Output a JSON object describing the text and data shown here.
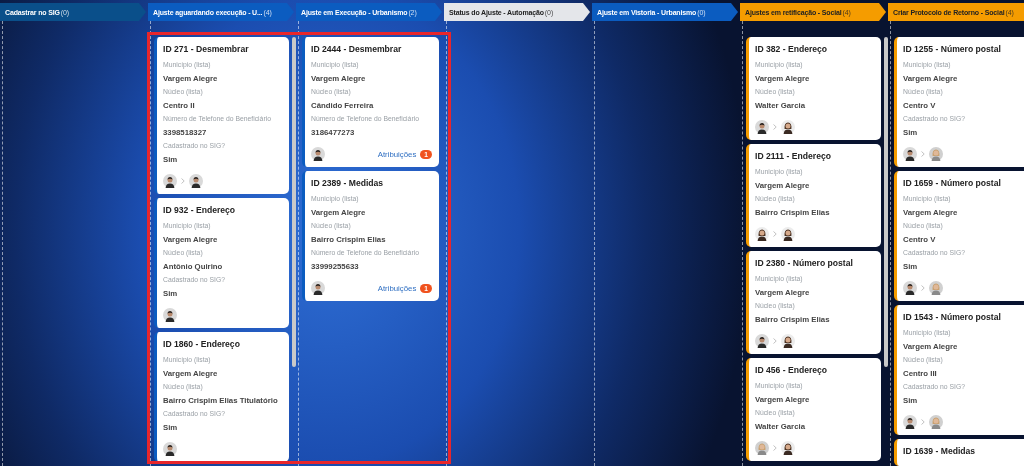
{
  "columns": [
    {
      "title": "Cadastrar no SIG",
      "count": "(0)",
      "color": "#0a4f8a",
      "scrollable": false
    },
    {
      "title": "Ajuste aguardando execução - U...",
      "count": "(4)",
      "color": "#0b5cc0",
      "scrollable": true,
      "cards": [
        {
          "title": "ID 271 - Desmembrar",
          "fields": [
            {
              "label": "Município (lista)",
              "value": "Vargem Alegre"
            },
            {
              "label": "Núcleo (lista)",
              "value": "Centro II"
            },
            {
              "label": "Número de Telefone do Beneficiário",
              "value": "3398518327"
            },
            {
              "label": "Cadastrado no SIG?",
              "value": "Sim"
            }
          ],
          "assignees": [
            {
              "kind": "man"
            },
            {
              "kind": "man"
            }
          ]
        },
        {
          "title": "ID 932 - Endereço",
          "fields": [
            {
              "label": "Município (lista)",
              "value": "Vargem Alegre"
            },
            {
              "label": "Núcleo (lista)",
              "value": "Antônio Quirino"
            },
            {
              "label": "Cadastrado no SIG?",
              "value": "Sim"
            }
          ],
          "assignees": [
            {
              "kind": "man"
            }
          ]
        },
        {
          "title": "ID 1860 - Endereço",
          "fields": [
            {
              "label": "Município (lista)",
              "value": "Vargem Alegre"
            },
            {
              "label": "Núcleo (lista)",
              "value": "Bairro Crispim Elias Titulatório"
            },
            {
              "label": "Cadastrado no SIG?",
              "value": "Sim"
            }
          ],
          "assignees": [
            {
              "kind": "man"
            }
          ]
        }
      ]
    },
    {
      "title": "Ajuste em Execução - Urbanismo",
      "count": "(2)",
      "color": "#0b5cc0",
      "scrollable": false,
      "cards": [
        {
          "title": "ID 2444 - Desmembrar",
          "fields": [
            {
              "label": "Município (lista)",
              "value": "Vargem Alegre"
            },
            {
              "label": "Núcleo (lista)",
              "value": "Cândido Ferreira"
            },
            {
              "label": "Número de Telefone do Beneficiário",
              "value": "3186477273"
            }
          ],
          "assignees": [
            {
              "kind": "man"
            }
          ],
          "link": "Atribuições",
          "badge": "1"
        },
        {
          "title": "ID 2389 - Medidas",
          "fields": [
            {
              "label": "Município (lista)",
              "value": "Vargem Alegre"
            },
            {
              "label": "Núcleo (lista)",
              "value": "Bairro Crispim Elias"
            },
            {
              "label": "Número de Telefone do Beneficiário",
              "value": "33999255633"
            }
          ],
          "assignees": [
            {
              "kind": "man"
            }
          ],
          "link": "Atribuições",
          "badge": "1"
        }
      ]
    },
    {
      "title": "Status do Ajuste - Automação",
      "count": "(0)",
      "color": "#e4e6ea",
      "scrollable": false
    },
    {
      "title": "Ajuste em Vistoria - Urbanismo",
      "count": "(0)",
      "color": "#0b5cc0",
      "scrollable": false
    },
    {
      "title": "Ajustes em retificação - Social",
      "count": "(4)",
      "color": "#f59c00",
      "scrollable": true,
      "cards": [
        {
          "title": "ID 382 - Endereço",
          "fields": [
            {
              "label": "Município (lista)",
              "value": "Vargem Alegre"
            },
            {
              "label": "Núcleo (lista)",
              "value": "Walter Garcia"
            }
          ],
          "assignees": [
            {
              "kind": "man"
            },
            {
              "kind": "woman"
            }
          ]
        },
        {
          "title": "ID 2111 - Endereço",
          "fields": [
            {
              "label": "Município (lista)",
              "value": "Vargem Alegre"
            },
            {
              "label": "Núcleo (lista)",
              "value": "Bairro Crispim Elias"
            }
          ],
          "assignees": [
            {
              "kind": "woman"
            },
            {
              "kind": "woman"
            }
          ]
        },
        {
          "title": "ID 2380 - Número postal",
          "fields": [
            {
              "label": "Município (lista)",
              "value": "Vargem Alegre"
            },
            {
              "label": "Núcleo (lista)",
              "value": "Bairro Crispim Elias"
            }
          ],
          "assignees": [
            {
              "kind": "man"
            },
            {
              "kind": "woman"
            }
          ]
        },
        {
          "title": "ID 456 - Endereço",
          "fields": [
            {
              "label": "Município (lista)",
              "value": "Vargem Alegre"
            },
            {
              "label": "Núcleo (lista)",
              "value": "Walter Garcia"
            }
          ],
          "assignees": [
            {
              "kind": "blonde"
            },
            {
              "kind": "woman"
            }
          ]
        }
      ]
    },
    {
      "title": "Criar Protocolo de Retorno - Social",
      "count": "(4)",
      "color": "#f59c00",
      "scrollable": false,
      "cards": [
        {
          "title": "ID 1255 - Número postal",
          "fields": [
            {
              "label": "Município (lista)",
              "value": "Vargem Alegre"
            },
            {
              "label": "Núcleo (lista)",
              "value": "Centro V"
            },
            {
              "label": "Cadastrado no SIG?",
              "value": "Sim"
            }
          ],
          "assignees": [
            {
              "kind": "man"
            },
            {
              "kind": "blonde"
            }
          ]
        },
        {
          "title": "ID 1659 - Número postal",
          "fields": [
            {
              "label": "Município (lista)",
              "value": "Vargem Alegre"
            },
            {
              "label": "Núcleo (lista)",
              "value": "Centro V"
            },
            {
              "label": "Cadastrado no SIG?",
              "value": "Sim"
            }
          ],
          "assignees": [
            {
              "kind": "man"
            },
            {
              "kind": "blonde"
            }
          ]
        },
        {
          "title": "ID 1543 - Número postal",
          "fields": [
            {
              "label": "Município (lista)",
              "value": "Vargem Alegre"
            },
            {
              "label": "Núcleo (lista)",
              "value": "Centro III"
            },
            {
              "label": "Cadastrado no SIG?",
              "value": "Sim"
            }
          ],
          "assignees": [
            {
              "kind": "man"
            },
            {
              "kind": "blonde"
            }
          ]
        },
        {
          "title": "ID 1639 - Medidas"
        }
      ]
    }
  ]
}
